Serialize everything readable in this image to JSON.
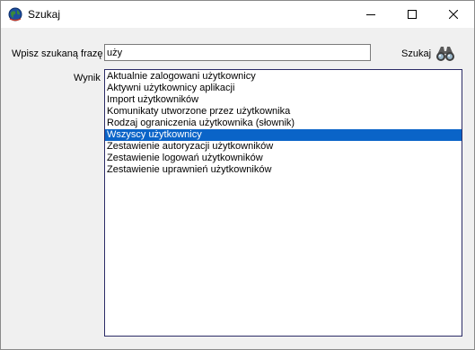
{
  "window": {
    "title": "Szukaj",
    "controls": [
      "minimize-icon",
      "maximize-icon",
      "close-icon"
    ]
  },
  "form": {
    "phrase_label": "Wpisz szukaną frazę",
    "phrase_value": "uży",
    "search_button_label": "Szukaj",
    "search_button_icon": "binoculars-icon",
    "result_label": "Wynik"
  },
  "results": {
    "selected_index": 5,
    "items": [
      "Aktualnie zalogowani użytkownicy",
      "Aktywni użytkownicy aplikacji",
      "Import użytkowników",
      "Komunikaty utworzone przez użytkownika",
      "Rodzaj ograniczenia użytkownika (słownik)",
      "Wszyscy użytkownicy",
      "Zestawienie autoryzacji użytkowników",
      "Zestawienie logowań użytkowników",
      "Zestawienie uprawnień użytkowników"
    ]
  },
  "colors": {
    "selection": "#0a64c8",
    "title_bar": "#ffffff",
    "window_bg": "#f0f0f0"
  }
}
